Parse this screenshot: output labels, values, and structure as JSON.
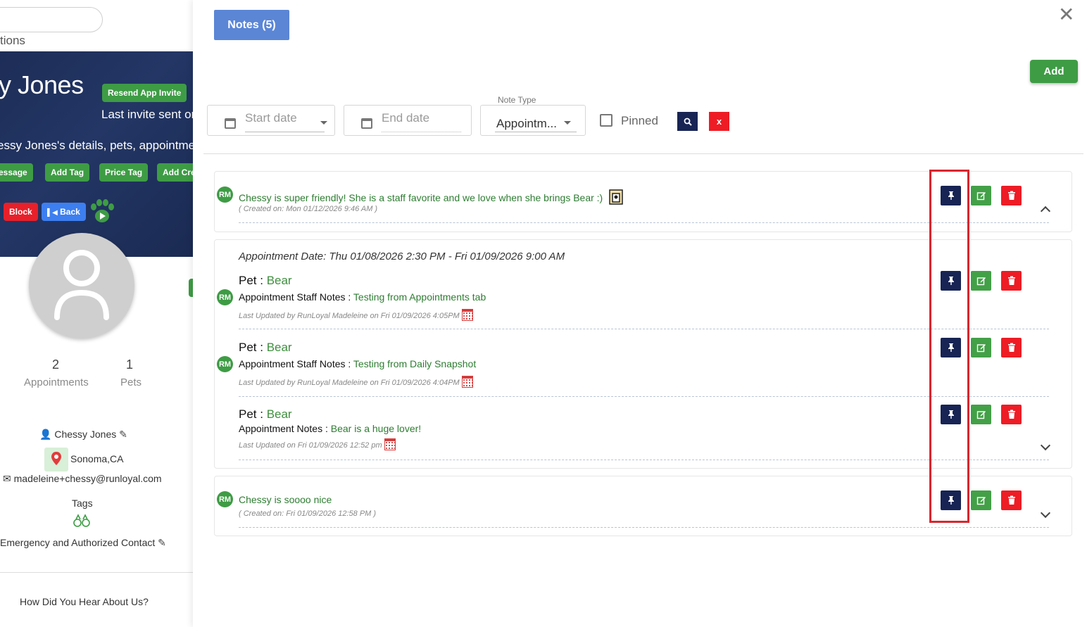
{
  "background_page": {
    "breadcrumb_fragment": "tions",
    "customer_name_fragment": "y Jones",
    "resend_invite_label": "Resend App Invite",
    "invite_text_fragment": "Last invite sent on",
    "details_text_fragment": "essy Jones's details, pets, appointments",
    "action_buttons": [
      "essage",
      "Add Tag",
      "Price Tag",
      "Add Cre"
    ],
    "block_label": "Block",
    "back_label": "Back",
    "stats": [
      {
        "value": "2",
        "label": "Appointments"
      },
      {
        "value": "1",
        "label": "Pets"
      }
    ],
    "contact_name": "Chessy Jones",
    "location": "Sonoma,CA",
    "email": "madeleine+chessy@runloyal.com",
    "tags_heading": "Tags",
    "emergency_contact_label": "Emergency and Authorized Contact",
    "how_heard_label": "How Did You Hear About Us?"
  },
  "modal": {
    "tab_label": "Notes (5)",
    "close_symbol": "✕",
    "add_label": "Add",
    "filters": {
      "start_date_placeholder": "Start date",
      "end_date_placeholder": "End date",
      "note_type_label": "Note Type",
      "note_type_value": "Appointm...",
      "pinned_label": "Pinned",
      "clear_symbol": "x"
    },
    "notes": [
      {
        "initials": "RM",
        "text": "Chessy is super friendly! She is a staff favorite and we love when she brings Bear :)",
        "meta": "( Created on: Mon 01/12/2026 9:46 AM )"
      },
      {
        "appointment_date": "Appointment Date: Thu 01/08/2026 2:30 PM - Fri 01/09/2026 9:00 AM",
        "entries": [
          {
            "pet_label": "Pet : ",
            "pet_name": "Bear",
            "initials": "RM",
            "field_label": "Appointment Staff Notes : ",
            "field_value": "Testing from Appointments tab",
            "meta": "Last Updated by RunLoyal Madeleine on Fri 01/09/2026 4:05PM"
          },
          {
            "pet_label": "Pet : ",
            "pet_name": "Bear",
            "initials": "RM",
            "field_label": "Appointment Staff Notes : ",
            "field_value": "Testing from Daily Snapshot",
            "meta": "Last Updated by RunLoyal Madeleine on Fri 01/09/2026 4:04PM"
          },
          {
            "pet_label": "Pet : ",
            "pet_name": "Bear",
            "field_label": "Appointment Notes : ",
            "field_value": "Bear is a huge lover!",
            "meta": "Last Updated on Fri 01/09/2026 12:52 pm"
          }
        ]
      },
      {
        "initials": "RM",
        "text": "Chessy is soooo nice",
        "meta": "( Created on: Fri 01/09/2026 12:58 PM )"
      }
    ]
  },
  "colors": {
    "primary_green": "#3e9c45",
    "pin_navy": "#172454",
    "delete_red": "#ee1c25",
    "tab_blue": "#5b86d6",
    "highlight_red": "#d9262e"
  }
}
